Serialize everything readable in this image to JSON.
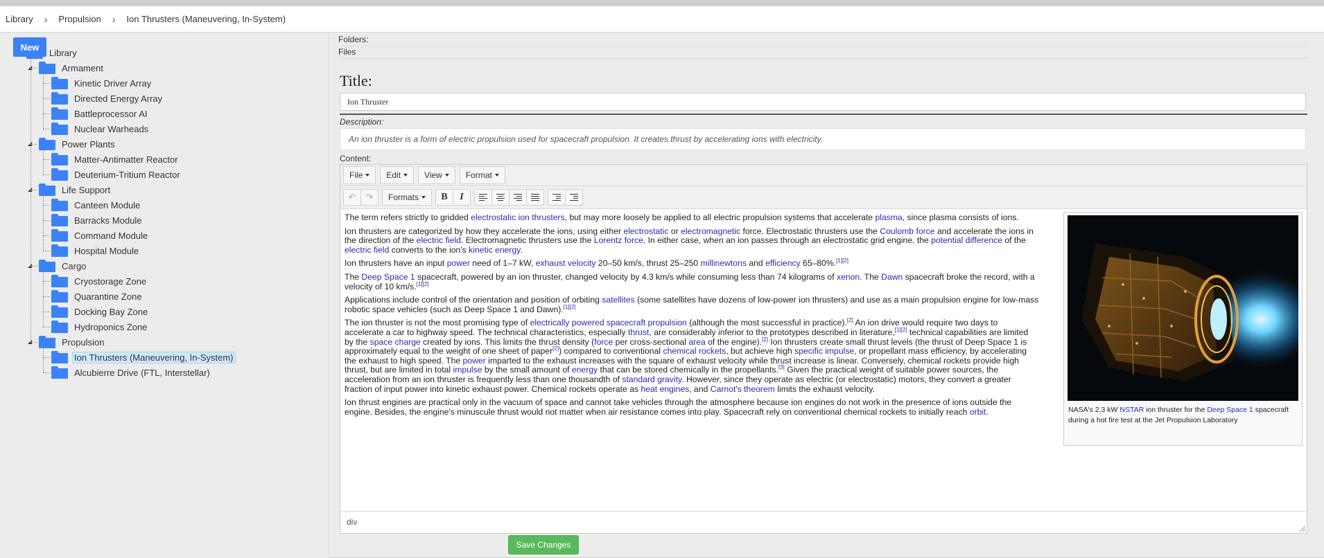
{
  "breadcrumb": [
    "Library",
    "Propulsion",
    "Ion Thrusters (Maneuvering, In-System)"
  ],
  "sidebar": {
    "new_label": "New",
    "tree": {
      "root": "Library",
      "groups": [
        {
          "label": "Armament",
          "items": [
            "Kinetic Driver Array",
            "Directed Energy Array",
            "Battleprocessor AI",
            "Nuclear Warheads"
          ]
        },
        {
          "label": "Power Plants",
          "items": [
            "Matter-Antimatter Reactor",
            "Deuterium-Tritium Reactor"
          ]
        },
        {
          "label": "Life Support",
          "items": [
            "Canteen Module",
            "Barracks Module",
            "Command Module",
            "Hospital Module"
          ]
        },
        {
          "label": "Cargo",
          "items": [
            "Cryostorage Zone",
            "Quarantine Zone",
            "Docking Bay Zone",
            "Hydroponics Zone"
          ]
        },
        {
          "label": "Propulsion",
          "items": [
            "Ion Thrusters (Maneuvering, In-System)",
            "Alcubierre Drive (FTL, Interstellar)"
          ]
        }
      ],
      "selected": "Ion Thrusters (Maneuvering, In-System)"
    }
  },
  "main": {
    "folders_label": "Folders:",
    "files_label": "Files",
    "title_label": "Title:",
    "title_value": "Ion Thruster",
    "description_label": "Description:",
    "description_value": "An ion thruster is a form of electric propulsion used for spacecraft propulsion. It creates thrust by accelerating ions with electricity.",
    "content_label": "Content:",
    "menubar": [
      "File",
      "Edit",
      "View",
      "Format"
    ],
    "toolbar_formats_label": "Formats",
    "status_path": "div",
    "save_label": "Save Changes",
    "figure_caption": {
      "t1": "NASA's 2.3 kW ",
      "l1": "NSTAR",
      "t2": " ion thruster for the ",
      "l2": "Deep Space 1",
      "t3": " spacecraft during a hot fire test at the Jet Propulsion Laboratory"
    }
  }
}
